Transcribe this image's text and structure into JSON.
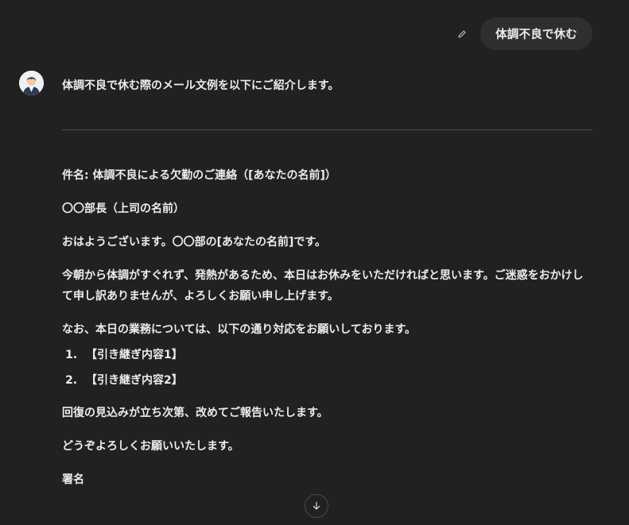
{
  "user_message": {
    "text": "体調不良で休む",
    "edit_icon": "pencil-icon"
  },
  "assistant": {
    "avatar_icon": "assistant-avatar",
    "intro": "体調不良で休む際のメール文例を以下にご紹介します。",
    "email": {
      "subject_label": "件名:",
      "subject": "体調不良による欠勤のご連絡（[あなたの名前]）",
      "recipient": "〇〇部長（上司の名前）",
      "greeting": "おはようございます。〇〇部の[あなたの名前]です。",
      "body1": "今朝から体調がすぐれず、発熱があるため、本日はお休みをいただければと思います。ご迷惑をおかけして申し訳ありませんが、よろしくお願い申し上げます。",
      "tasks_intro": "なお、本日の業務については、以下の通り対応をお願いしております。",
      "tasks": [
        "【引き継ぎ内容1】",
        "【引き継ぎ内容2】"
      ],
      "recovery": "回復の見込みが立ち次第、改めてご報告いたします。",
      "closing": "どうぞよろしくお願いいたします。",
      "signature": "署名"
    }
  },
  "scroll_button_icon": "arrow-down-icon"
}
